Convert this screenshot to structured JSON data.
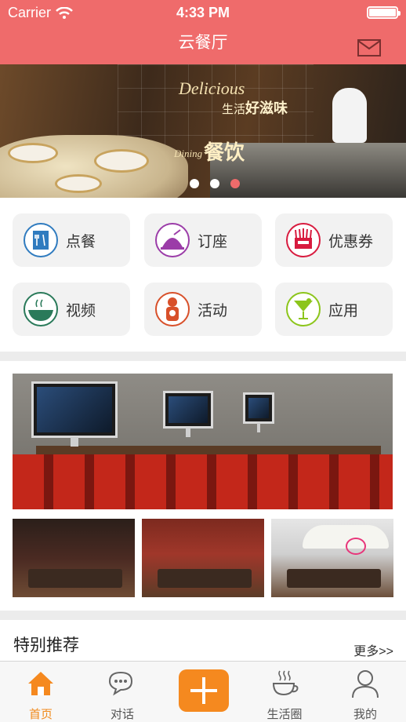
{
  "status": {
    "carrier": "Carrier",
    "time": "4:33 PM"
  },
  "header": {
    "title": "云餐厅",
    "mail_icon": "mail-icon"
  },
  "banner": {
    "en_top": "Delicious",
    "cn_top_small": "生活",
    "cn_top_big": "好滋味",
    "en_bottom": "Dining",
    "cn_bottom": "餐饮",
    "active_dot": 3,
    "dot_count": 3
  },
  "quick": [
    {
      "label": "点餐",
      "icon": "menu-order-icon",
      "color": "#2f7bbf"
    },
    {
      "label": "订座",
      "icon": "reservation-bell-icon",
      "color": "#9b3ca8"
    },
    {
      "label": "优惠券",
      "icon": "coupon-icon",
      "color": "#d81b3f"
    },
    {
      "label": "视频",
      "icon": "video-bowl-icon",
      "color": "#2a7a5a"
    },
    {
      "label": "活动",
      "icon": "activity-icon",
      "color": "#d8502a"
    },
    {
      "label": "应用",
      "icon": "cocktail-icon",
      "color": "#8cc51b"
    }
  ],
  "recommend": {
    "title": "特别推荐",
    "more": "更多>>"
  },
  "tabs": [
    {
      "label": "首页",
      "icon": "home-icon",
      "active": true
    },
    {
      "label": "对话",
      "icon": "chat-icon",
      "active": false
    },
    {
      "label": "",
      "icon": "add-icon",
      "active": false
    },
    {
      "label": "生活圈",
      "icon": "coffee-cup-icon",
      "active": false
    },
    {
      "label": "我的",
      "icon": "profile-icon",
      "active": false
    }
  ],
  "colors": {
    "accent": "#ef6b6b",
    "tab_active": "#f08a1c",
    "plus": "#f5891f"
  }
}
